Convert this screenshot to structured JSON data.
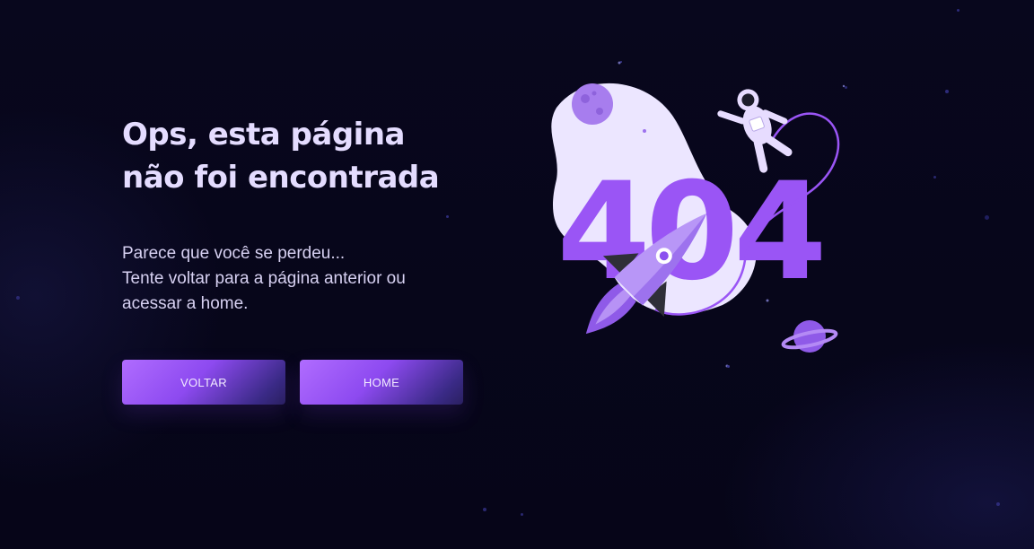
{
  "hero": {
    "title_line1": "Ops, esta página",
    "title_line2": "não foi encontrada",
    "desc_line1": "Parece que você se perdeu...",
    "desc_line2": "Tente voltar para a página anterior ou",
    "desc_line3": "acessar a home."
  },
  "actions": {
    "back_label": "VOLTAR",
    "home_label": "HOME"
  },
  "illustration": {
    "error_code": "404",
    "icons": [
      "moon-icon",
      "astronaut-icon",
      "rocket-icon",
      "planet-icon"
    ]
  },
  "colors": {
    "background": "#07061c",
    "heading": "#e4dcff",
    "accent": "#9a55f5",
    "blob": "#ece6ff"
  }
}
